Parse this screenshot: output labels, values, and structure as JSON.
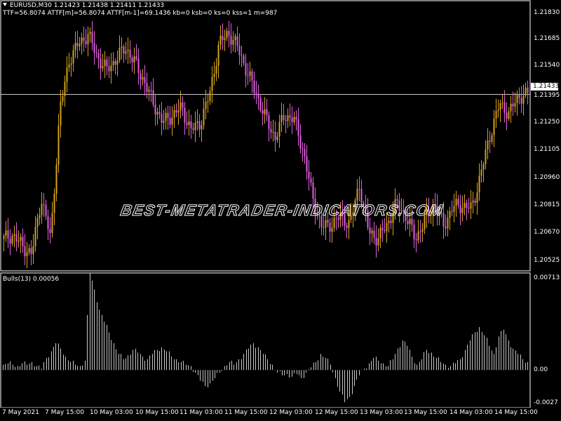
{
  "header": {
    "symbol_line": "EURUSD,M30  1.21423 1.21438 1.21411 1.21433",
    "indicator_line": "TTF=56.8074 ATTF[m]=56.8074 ATTF[m-1]=69.1436 kb=0 ksb=0 ks=0 kss=1 m=987"
  },
  "watermark": "BEST-METATRADER-INDICATORS.COM",
  "price_axis": {
    "labels": [
      "1.21830",
      "1.21685",
      "1.21540",
      "1.21395",
      "1.21250",
      "1.21105",
      "1.20960",
      "1.20815",
      "1.20670",
      "1.20525"
    ],
    "current_price": "1.21433"
  },
  "indicator": {
    "title": "Bulls(13) 0.00056",
    "axis_labels": [
      "0.00713",
      "0.00",
      "-0.0027"
    ]
  },
  "time_axis": {
    "labels": [
      "7 May 2021",
      "7 May 15:00",
      "10 May 03:00",
      "10 May 15:00",
      "11 May 03:00",
      "11 May 15:00",
      "12 May 03:00",
      "12 May 15:00",
      "13 May 03:00",
      "13 May 15:00",
      "14 May 03:00",
      "14 May 15:00"
    ]
  },
  "colors": {
    "background": "#000000",
    "bull_candle": "#d4a21a",
    "bear_candle": "#e060e0",
    "indicator_bars": "#c8c8c8",
    "grid_line": "#ffffff"
  },
  "chart_data": [
    {
      "type": "candlestick",
      "title": "EURUSD,M30",
      "xlabel": "",
      "ylabel": "",
      "ylim": [
        1.2049,
        1.2193
      ],
      "x": [
        "7 May 2021",
        "7 May 15:00",
        "10 May 03:00",
        "10 May 15:00",
        "11 May 03:00",
        "11 May 15:00",
        "12 May 03:00",
        "12 May 15:00",
        "13 May 03:00",
        "13 May 15:00",
        "14 May 03:00",
        "14 May 15:00"
      ],
      "close_path": [
        1.2066,
        1.2068,
        1.2062,
        1.2058,
        1.2088,
        1.2066,
        1.2135,
        1.2162,
        1.217,
        1.2175,
        1.2163,
        1.2156,
        1.2162,
        1.2168,
        1.216,
        1.215,
        1.2138,
        1.2128,
        1.2132,
        1.2136,
        1.2124,
        1.2128,
        1.2143,
        1.217,
        1.2176,
        1.2168,
        1.2155,
        1.2143,
        1.213,
        1.212,
        1.2132,
        1.213,
        1.2113,
        1.2088,
        1.2072,
        1.2074,
        1.2078,
        1.2074,
        1.2095,
        1.207,
        1.2066,
        1.2074,
        1.2085,
        1.2078,
        1.2066,
        1.2076,
        1.2085,
        1.2073,
        1.2083,
        1.2084,
        1.2082,
        1.2101,
        1.2122,
        1.2138,
        1.2133,
        1.2142,
        1.2143
      ],
      "current_price": 1.21433
    },
    {
      "type": "bar",
      "title": "Bulls(13)",
      "last_value": 0.00056,
      "ylim": [
        -0.0027,
        0.00713
      ],
      "values": [
        0.0004,
        0.0005,
        0.0004,
        0.0003,
        0.0005,
        0.0004,
        0.0006,
        0.0003,
        0.0001,
        0.0009,
        0.0014,
        0.002,
        0.0016,
        0.001,
        0.0006,
        0.0004,
        0.0003,
        0.0007,
        0.0072,
        0.006,
        0.0045,
        0.0036,
        0.0028,
        0.002,
        0.0012,
        0.0008,
        0.0011,
        0.0015,
        0.0013,
        0.001,
        0.0008,
        0.0012,
        0.0015,
        0.0017,
        0.0014,
        0.001,
        0.0008,
        0.0006,
        0.0004,
        0.0003,
        -0.0002,
        -0.0008,
        -0.0012,
        -0.001,
        -0.0006,
        -0.0002,
        0.0003,
        0.0006,
        0.0004,
        0.0008,
        0.0012,
        0.0016,
        0.002,
        0.0017,
        0.0012,
        0.0008,
        0.0004,
        -0.0002,
        -0.0004,
        -0.0003,
        -0.0005,
        -0.0003,
        -0.0006,
        -0.0002,
        0.0002,
        0.0006,
        0.0012,
        0.0009,
        0.0004,
        -0.0006,
        -0.0016,
        -0.0024,
        -0.002,
        -0.0012,
        -0.0004,
        0.0001,
        0.0005,
        0.0009,
        0.0007,
        0.0005,
        0.0003,
        0.0008,
        0.0016,
        0.0022,
        0.0018,
        0.001,
        0.0004,
        0.0008,
        0.0015,
        0.0013,
        0.0009,
        0.0006,
        0.0004,
        0.0003,
        0.0005,
        0.0008,
        0.0015,
        0.0022,
        0.0028,
        0.0032,
        0.0026,
        0.0018,
        0.0012,
        0.0025,
        0.003,
        0.0022,
        0.0016,
        0.0012,
        0.0008,
        0.0006
      ]
    }
  ]
}
